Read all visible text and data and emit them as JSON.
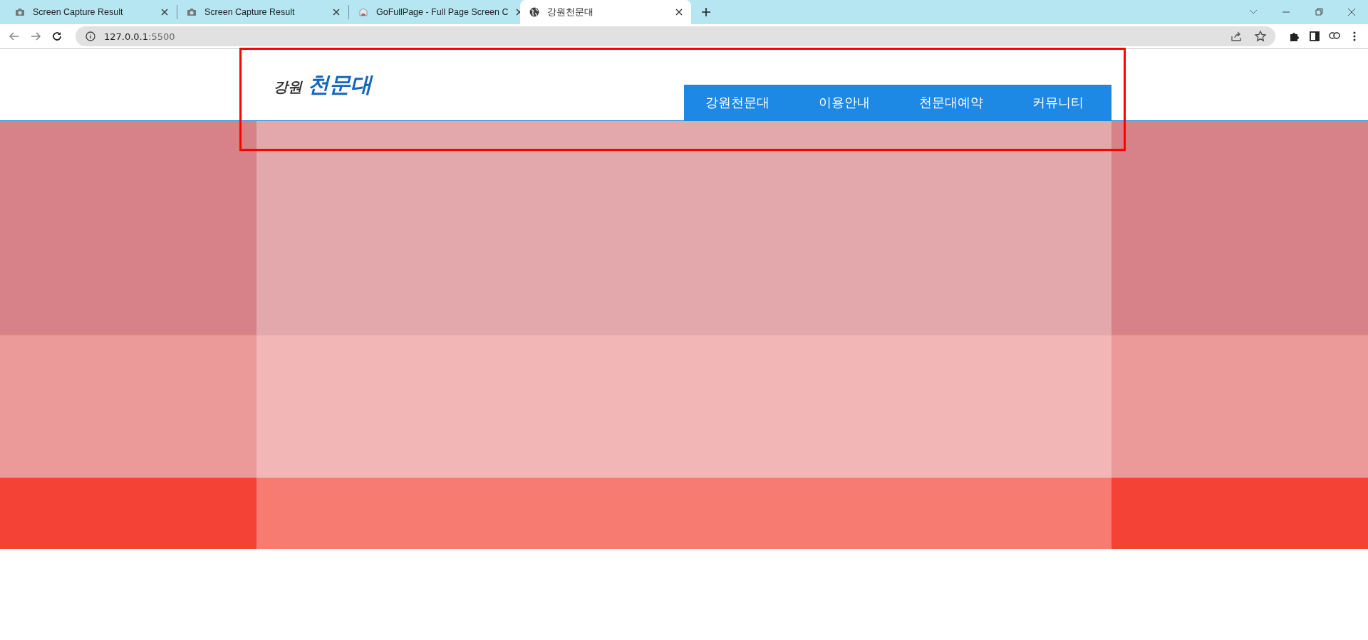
{
  "browser": {
    "tabs": [
      {
        "title": "Screen Capture Result",
        "kind": "camera",
        "selected": false
      },
      {
        "title": "Screen Capture Result",
        "kind": "camera",
        "selected": false
      },
      {
        "title": "GoFullPage - Full Page Screen C",
        "kind": "app",
        "selected": false
      },
      {
        "title": "강원천문대",
        "kind": "globe",
        "selected": true
      }
    ],
    "address": {
      "host": "127.0.0.1",
      "port": ":5500"
    }
  },
  "page": {
    "logo": {
      "prefix": "강원",
      "name": "천문대"
    },
    "nav": [
      {
        "label": "강원천문대"
      },
      {
        "label": "이용안내"
      },
      {
        "label": "천문대예약"
      },
      {
        "label": "커뮤니티"
      }
    ],
    "highlight_box": true
  }
}
